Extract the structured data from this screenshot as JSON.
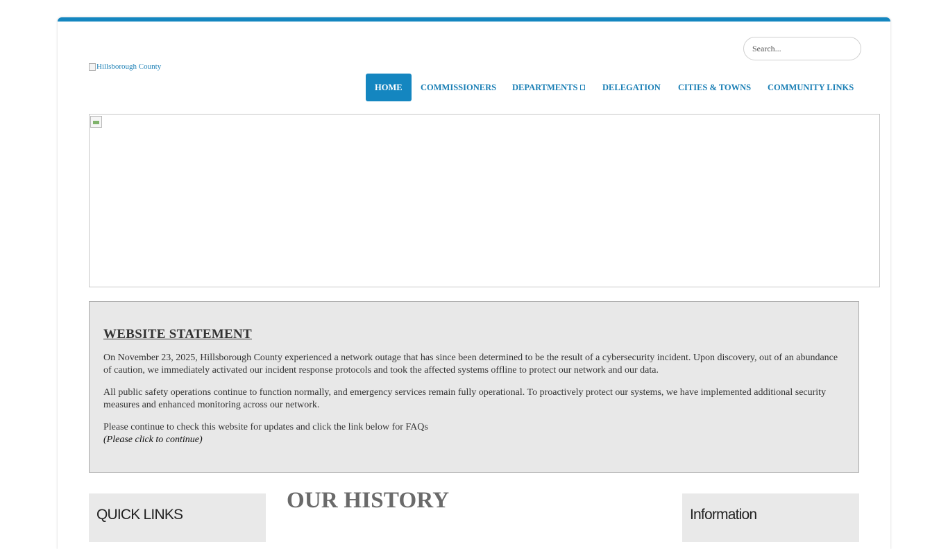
{
  "header": {
    "logo_alt": "Hillsborough County",
    "search_placeholder": "Search..."
  },
  "nav": {
    "items": [
      {
        "label": "HOME",
        "active": true
      },
      {
        "label": "COMMISSIONERS"
      },
      {
        "label": "DEPARTMENTS",
        "has_dropdown": true
      },
      {
        "label": "DELEGATION"
      },
      {
        "label": "CITIES & TOWNS"
      },
      {
        "label": "COMMUNITY LINKS"
      }
    ]
  },
  "statement": {
    "title": "WEBSITE STATEMENT",
    "paragraph1": "On November 23, 2025, Hillsborough County experienced a network outage that has since been determined to be the result of a cybersecurity incident. Upon discovery, out of an abundance of caution, we immediately activated our incident response protocols and took the affected systems offline to protect our network and our data.",
    "paragraph2": "All public safety operations continue to function normally, and emergency services remain fully operational. To proactively protect our systems, we have implemented additional security measures and enhanced monitoring across our network.",
    "paragraph3": "Please continue to check this website for updates and click the link below for FAQs",
    "continue_link": "(Please click to continue)"
  },
  "sections": {
    "quick_links_title": "QUICK LINKS",
    "history_title": "OUR HISTORY",
    "information_title": "Information"
  },
  "colors": {
    "accent": "#1486c0",
    "link": "#1a7fb5",
    "statement_bg": "#e8e8e8",
    "heading_gray": "#6a6a6a"
  }
}
